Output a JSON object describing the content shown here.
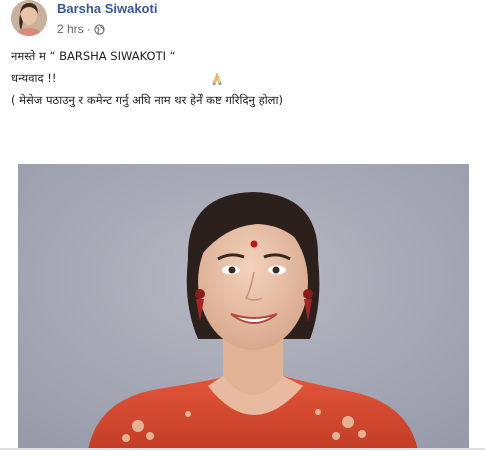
{
  "post": {
    "author": "Barsha Siwakoti",
    "timestamp": "2 hrs",
    "separator": "·",
    "privacy_icon": "globe-icon",
    "lines": [
      "नमस्ते म “ BARSHA SIWAKOTI “",
      "धन्यवाद !!",
      "( मेसेज पठाउनु र कमेन्ट गर्नु अघि नाम थर हेर्नें कष्ट गरिदिनु होला)"
    ],
    "emoji": "folded-hands-emoji",
    "photo_icon": "portrait-photo",
    "link_color": "#385898",
    "meta_color": "#616770"
  }
}
